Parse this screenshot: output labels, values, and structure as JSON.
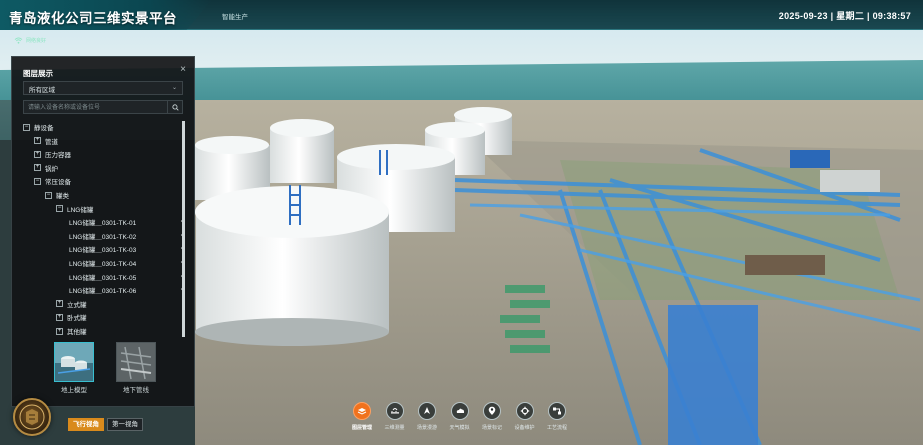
{
  "header": {
    "app_title": "青岛液化公司三维实景平台",
    "nav_tab": "智能生产",
    "datetime": "2025-09-23 | 星期二 | 09:38:57"
  },
  "status": {
    "network_label": "网络良好"
  },
  "layer_panel": {
    "title": "图层展示",
    "region_select_value": "所有区域",
    "search_placeholder": "请输入设备名称或设备位号",
    "tree": [
      {
        "label": "静设备",
        "toggle": "−",
        "depth": 0
      },
      {
        "label": "管道",
        "toggle": "+",
        "depth": 1
      },
      {
        "label": "压力容器",
        "toggle": "+",
        "depth": 1
      },
      {
        "label": "锅炉",
        "toggle": "+",
        "depth": 1
      },
      {
        "label": "常压设备",
        "toggle": "−",
        "depth": 1
      },
      {
        "label": "罐类",
        "toggle": "−",
        "depth": 2
      },
      {
        "label": "LNG储罐",
        "toggle": "−",
        "depth": 3
      },
      {
        "label": "LNG储罐＿0301-TK-01",
        "depth": 4
      },
      {
        "label": "LNG储罐＿0301-TK-02",
        "depth": 4
      },
      {
        "label": "LNG储罐＿0301-TK-03",
        "depth": 4
      },
      {
        "label": "LNG储罐＿0301-TK-04",
        "depth": 4
      },
      {
        "label": "LNG储罐＿0301-TK-05",
        "depth": 4
      },
      {
        "label": "LNG储罐＿0301-TK-06",
        "depth": 4
      },
      {
        "label": "立式罐",
        "toggle": "+",
        "depth": 3
      },
      {
        "label": "卧式罐",
        "toggle": "+",
        "depth": 3
      },
      {
        "label": "其他罐",
        "toggle": "+",
        "depth": 3
      }
    ],
    "thumbnails": [
      {
        "label": "地上模型",
        "selected": true
      },
      {
        "label": "地下管线",
        "selected": false
      }
    ]
  },
  "view_buttons": {
    "fly_view": "飞行视角",
    "first_view": "第一视角"
  },
  "toolbar": [
    {
      "label": "图层管理",
      "icon": "layers-icon",
      "active": true
    },
    {
      "label": "三维测量",
      "icon": "measure-icon",
      "active": false
    },
    {
      "label": "场景漫游",
      "icon": "navigate-icon",
      "active": false
    },
    {
      "label": "天气模拟",
      "icon": "cloud-icon",
      "active": false
    },
    {
      "label": "场景标记",
      "icon": "marker-icon",
      "active": false
    },
    {
      "label": "设备维护",
      "icon": "gear-icon",
      "active": false
    },
    {
      "label": "工艺流程",
      "icon": "process-icon",
      "active": false
    }
  ],
  "colors": {
    "accent_orange": "#f0721e",
    "header_teal": "#0e5a64",
    "fly_view_button": "#d98a1c",
    "pipe_blue": "#3b8fd8"
  }
}
